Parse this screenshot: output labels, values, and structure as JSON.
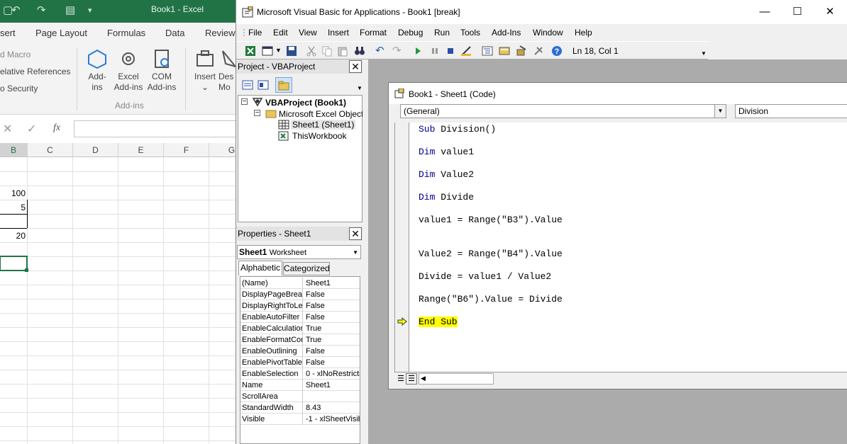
{
  "excel": {
    "title": "Book1  -  Excel",
    "tabs": [
      "sert",
      "Page Layout",
      "Formulas",
      "Data",
      "Review"
    ],
    "ribbon_left": [
      "d Macro",
      "elative References",
      "o Security"
    ],
    "buttons": [
      {
        "label": "Add-",
        "label2": "ins"
      },
      {
        "label": "Excel",
        "label2": "Add-ins"
      },
      {
        "label": "COM",
        "label2": "Add-ins"
      },
      {
        "label": "Insert",
        "label2": "⌄"
      },
      {
        "label": "Des",
        "label2": "Mo"
      }
    ],
    "group_label": "Add-ins",
    "fx_label": "fx",
    "columns": [
      "B",
      "C",
      "D",
      "E",
      "F",
      "G"
    ],
    "cells": [
      "100",
      "5",
      "20"
    ]
  },
  "vba": {
    "title": "Microsoft Visual Basic for Applications - Book1 [break]",
    "menu": [
      "File",
      "Edit",
      "View",
      "Insert",
      "Format",
      "Debug",
      "Run",
      "Tools",
      "Add-Ins",
      "Window",
      "Help"
    ],
    "status": "Ln 18, Col 1",
    "project_header": "Project - VBAProject",
    "tree": {
      "root": "VBAProject (Book1)",
      "folder": "Microsoft Excel Objects",
      "sheet": "Sheet1 (Sheet1)",
      "workbook": "ThisWorkbook"
    },
    "properties_header": "Properties - Sheet1",
    "object_combo": {
      "name": "Sheet1",
      "type": "Worksheet"
    },
    "prop_tabs": [
      "Alphabetic",
      "Categorized"
    ],
    "props": [
      {
        "k": "(Name)",
        "v": "Sheet1"
      },
      {
        "k": "DisplayPageBreak",
        "v": "False"
      },
      {
        "k": "DisplayRightToLef",
        "v": "False"
      },
      {
        "k": "EnableAutoFilter",
        "v": "False"
      },
      {
        "k": "EnableCalculation",
        "v": "True"
      },
      {
        "k": "EnableFormatCon",
        "v": "True"
      },
      {
        "k": "EnableOutlining",
        "v": "False"
      },
      {
        "k": "EnablePivotTable",
        "v": "False"
      },
      {
        "k": "EnableSelection",
        "v": "0 - xlNoRestricti"
      },
      {
        "k": "Name",
        "v": "Sheet1"
      },
      {
        "k": "ScrollArea",
        "v": ""
      },
      {
        "k": "StandardWidth",
        "v": "8.43"
      },
      {
        "k": "Visible",
        "v": "-1 - xlSheetVisib"
      }
    ],
    "code_window": {
      "title": "Book1 - Sheet1 (Code)",
      "general_combo": "(General)",
      "proc_combo": "Division",
      "lines": [
        {
          "kw": "Sub",
          "rest": " Division()"
        },
        {
          "kw": "Dim",
          "rest": " value1"
        },
        {
          "kw": "Dim",
          "rest": " Value2"
        },
        {
          "kw": "Dim",
          "rest": " Divide"
        },
        {
          "kw": "",
          "rest": "value1 = Range(\"B3\").Value"
        },
        {
          "kw": "",
          "rest": "Value2 = Range(\"B4\").Value"
        },
        {
          "kw": "",
          "rest": "Divide = value1 / Value2"
        },
        {
          "kw": "",
          "rest": "Range(\"B6\").Value = Divide"
        }
      ],
      "end_line": "End Sub"
    }
  }
}
